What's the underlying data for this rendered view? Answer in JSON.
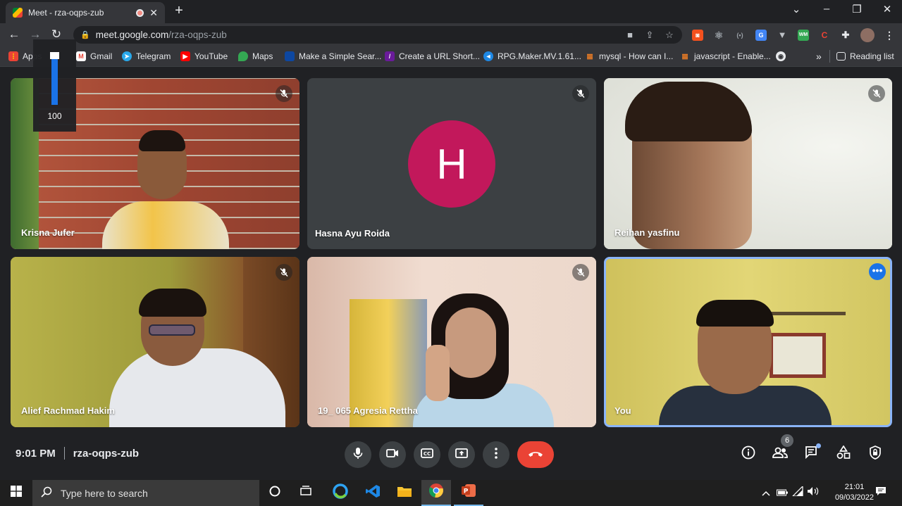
{
  "browser": {
    "tab_title": "Meet - rza-oqps-zub",
    "url_host": "meet.google.com",
    "url_path": "/rza-oqps-zub",
    "bookmarks": [
      {
        "label": "Apps"
      },
      {
        "label": "Gmail"
      },
      {
        "label": "Telegram"
      },
      {
        "label": "YouTube"
      },
      {
        "label": "Maps"
      },
      {
        "label": "Make a Simple Sear..."
      },
      {
        "label": "Create a URL Short..."
      },
      {
        "label": "RPG.Maker.MV.1.61..."
      },
      {
        "label": "mysql - How can I..."
      },
      {
        "label": "javascript - Enable..."
      }
    ],
    "reading_list": "Reading list",
    "overflow": "»"
  },
  "volume": {
    "level": "100"
  },
  "participants": [
    {
      "name": "Krisna Jufer",
      "muted": true
    },
    {
      "name": "Hasna Ayu Roida",
      "muted": true,
      "initial": "H"
    },
    {
      "name": "Reihan yasfinu",
      "muted": true
    },
    {
      "name": "Alief Rachmad Hakim",
      "muted": true
    },
    {
      "name": "19_ 065 Agresia Rettha",
      "muted": true
    },
    {
      "name": "You",
      "muted": false
    }
  ],
  "meeting": {
    "time": "9:01 PM",
    "code": "rza-oqps-zub",
    "people_count": "6"
  },
  "taskbar": {
    "search_placeholder": "Type here to search",
    "time": "21:01",
    "date": "09/03/2022"
  },
  "colors": {
    "accent": "#1a73e8",
    "end_call": "#ea4335",
    "avatar": "#c2185b"
  }
}
